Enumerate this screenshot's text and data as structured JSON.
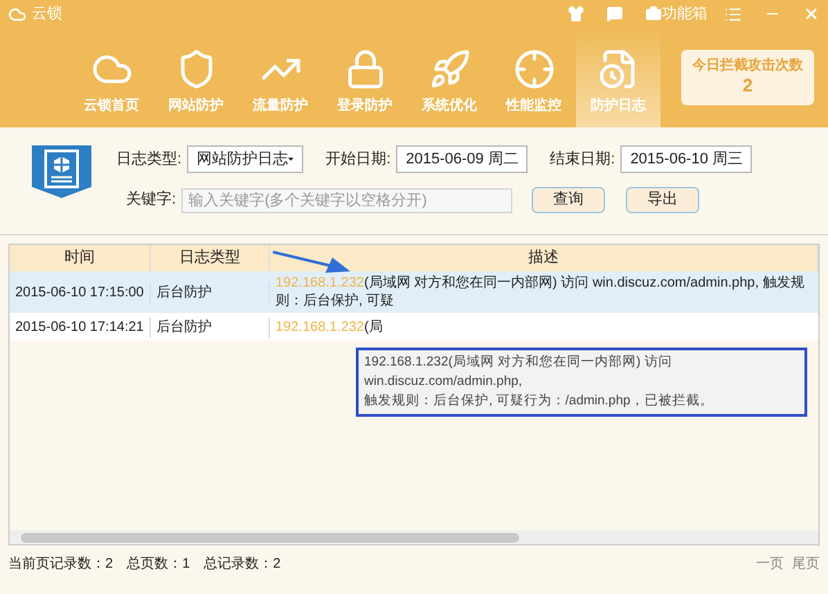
{
  "window": {
    "title": "云锁",
    "toolbox": "功能箱"
  },
  "nav": [
    {
      "label": "云锁首页",
      "selected": false
    },
    {
      "label": "网站防护",
      "selected": false
    },
    {
      "label": "流量防护",
      "selected": false
    },
    {
      "label": "登录防护",
      "selected": false
    },
    {
      "label": "系统优化",
      "selected": false
    },
    {
      "label": "性能监控",
      "selected": false
    },
    {
      "label": "防护日志",
      "selected": true
    }
  ],
  "counter": {
    "label": "今日拦截攻击次数",
    "value": "2"
  },
  "filters": {
    "log_type": {
      "label": "日志类型:",
      "value": "网站防护日志"
    },
    "start_date": {
      "label": "开始日期:",
      "value": "2015-06-09 周二"
    },
    "end_date": {
      "label": "结束日期:",
      "value": "2015-06-10 周三"
    },
    "keyword": {
      "label": "关键字:",
      "placeholder": "输入关键字(多个关键字以空格分开)"
    },
    "buttons": [
      "查询",
      "导出"
    ]
  },
  "table": {
    "columns": [
      "时间",
      "日志类型",
      "描述"
    ],
    "rows": [
      {
        "time": "2015-06-10 17:15:00",
        "type": "后台防护",
        "ip": "192.168.1.232",
        "description": "(局域网 对方和您在同一内部网) 访问 win.discuz.com/admin.php, 触发规则：后台保护, 可疑",
        "selected": true
      },
      {
        "time": "2015-06-10 17:14:21",
        "type": "后台防护",
        "ip": "192.168.1.232",
        "description": "(局",
        "selected": false
      }
    ]
  },
  "tooltip": [
    "192.168.1.232(局域网 对方和您在同一内部网) 访问 win.discuz.com/admin.php,",
    "触发规则：后台保护, 可疑行为：/admin.php，已被拦截。"
  ],
  "status": {
    "items": [
      "当前页记录数：2",
      "总页数：1",
      "总记录数：2"
    ],
    "pager": [
      "一页",
      "尾页"
    ]
  }
}
